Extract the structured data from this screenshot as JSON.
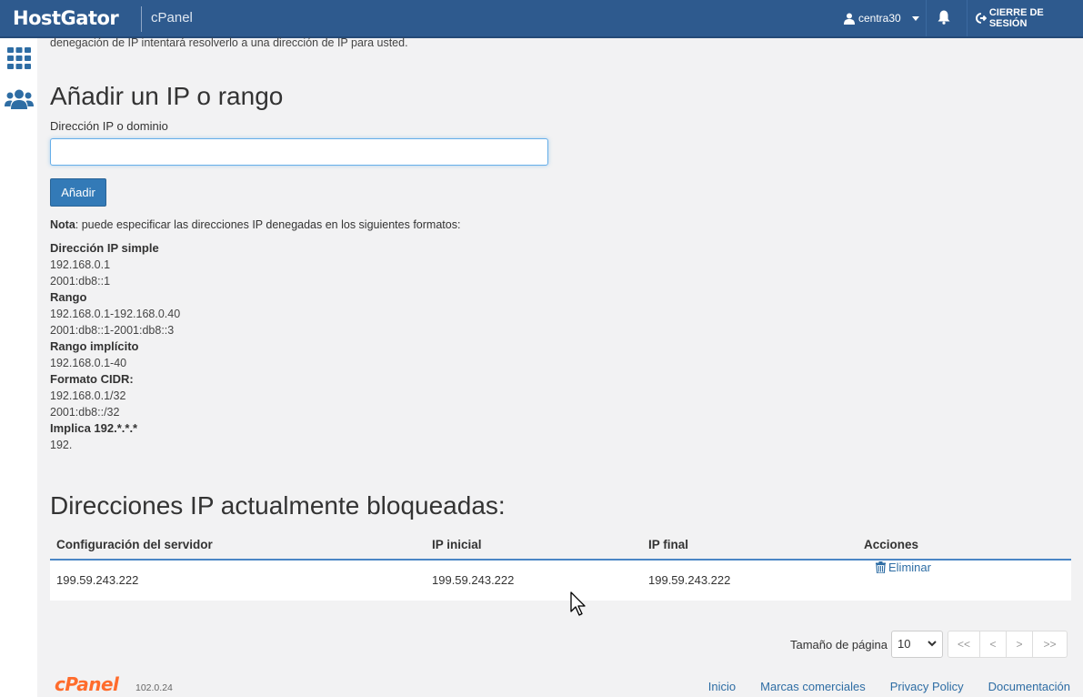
{
  "header": {
    "brand": "HostGator",
    "product": "cPanel",
    "user": "centra30",
    "logout_label": "CIERRE DE SESIÓN"
  },
  "main": {
    "intro_text": "denegación de IP intentará resolverlo a una dirección de IP para usted.",
    "add_heading": "Añadir un IP o rango",
    "ip_label": "Dirección IP o dominio",
    "ip_value": "",
    "add_button": "Añadir",
    "note_prefix": "Nota",
    "note_text": ": puede especificar las direcciones IP denegadas en los siguientes formatos:",
    "formats": [
      {
        "title": "Dirección IP simple",
        "examples": [
          "192.168.0.1",
          "2001:db8::1"
        ]
      },
      {
        "title": "Rango",
        "examples": [
          "192.168.0.1-192.168.0.40",
          "2001:db8::1-2001:db8::3"
        ]
      },
      {
        "title": "Rango implícito",
        "examples": [
          "192.168.0.1-40"
        ]
      },
      {
        "title": "Formato CIDR:",
        "examples": [
          "192.168.0.1/32",
          "2001:db8::/32"
        ]
      },
      {
        "title": "Implica 192.*.*.*",
        "examples": [
          "192."
        ]
      }
    ],
    "blocked_heading": "Direcciones IP actualmente bloqueadas:",
    "table": {
      "headers": [
        "Configuración del servidor",
        "IP inicial",
        "IP final",
        "Acciones"
      ],
      "rows": [
        {
          "server": "199.59.243.222",
          "start": "199.59.243.222",
          "end": "199.59.243.222",
          "action": "Eliminar"
        }
      ]
    },
    "pager": {
      "label": "Tamaño de página",
      "page_size": "10",
      "first": "<<",
      "prev": "<",
      "next": ">",
      "last": ">>"
    }
  },
  "footer": {
    "logo": "cPanel",
    "version": "102.0.24",
    "links": [
      "Inicio",
      "Marcas comerciales",
      "Privacy Policy",
      "Documentación"
    ]
  },
  "colors": {
    "header_bg": "#2e5a8e",
    "primary_button": "#337ab7",
    "link": "#2e6da4",
    "footer_logo": "#ff6c2c"
  }
}
